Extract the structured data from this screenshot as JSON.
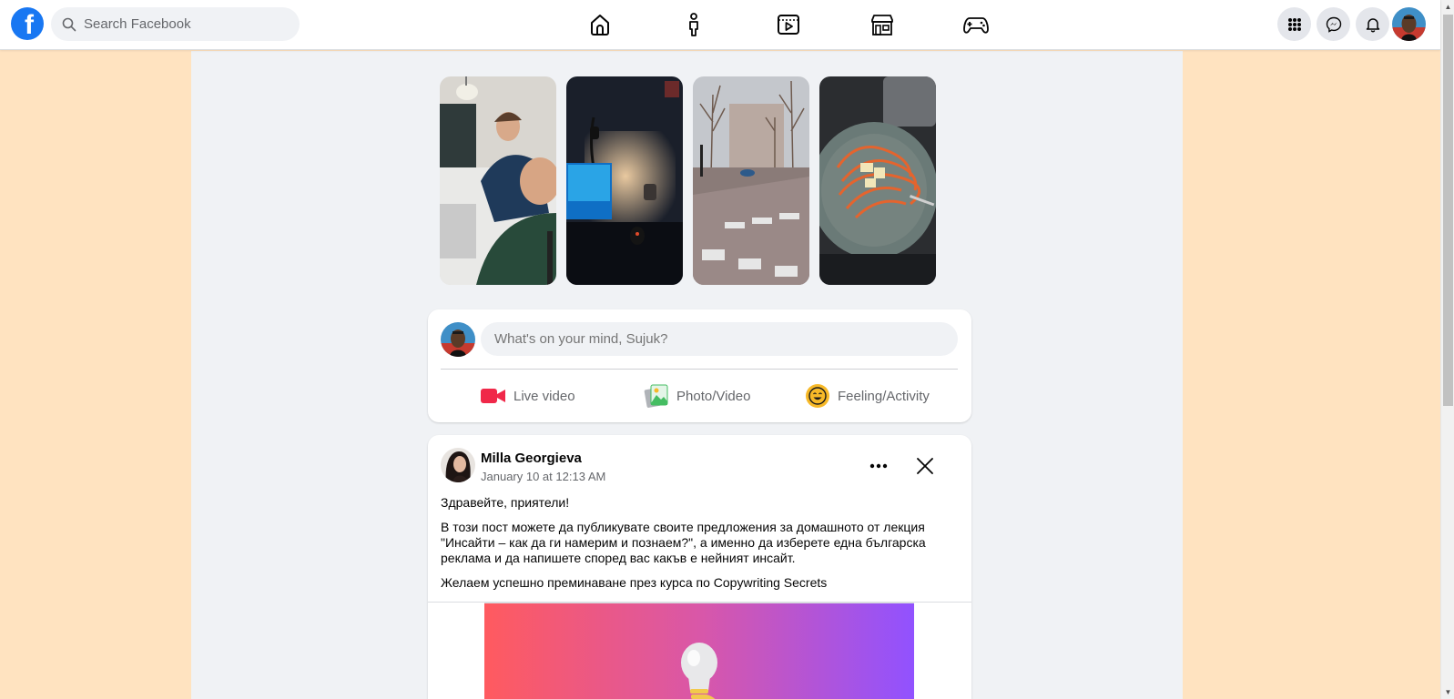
{
  "search": {
    "placeholder": "Search Facebook"
  },
  "nav": [
    "home-icon",
    "profile-icon",
    "watch-icon",
    "marketplace-icon",
    "gaming-icon"
  ],
  "header_buttons": [
    "menu-grid-icon",
    "messenger-icon",
    "notifications-icon"
  ],
  "composer": {
    "placeholder": "What's on your mind, Sujuk?",
    "actions": [
      {
        "label": "Live video",
        "icon": "live-video-icon",
        "color": "#f02849"
      },
      {
        "label": "Photo/Video",
        "icon": "photo-video-icon",
        "color": "#45bd62"
      },
      {
        "label": "Feeling/Activity",
        "icon": "feeling-icon",
        "color": "#f7b928"
      }
    ]
  },
  "post": {
    "author": "Milla Georgieva",
    "time": "January 10 at 12:13 AM",
    "paragraphs": [
      "Здравейте, приятели!",
      "В този пост можете да публикувате своите предложения за домашното от лекция \"Инсайти – как да ги намерим и познаем?\", а именно да изберете една българска реклама и да напишете според вас какъв е нейният инсайт.",
      "Желаем успешно преминаване през курса по Copywriting Secrets"
    ]
  },
  "colors": {
    "brand": "#1877f2",
    "page_bg": "#ffe3c0",
    "feed_bg": "#f0f2f5"
  }
}
